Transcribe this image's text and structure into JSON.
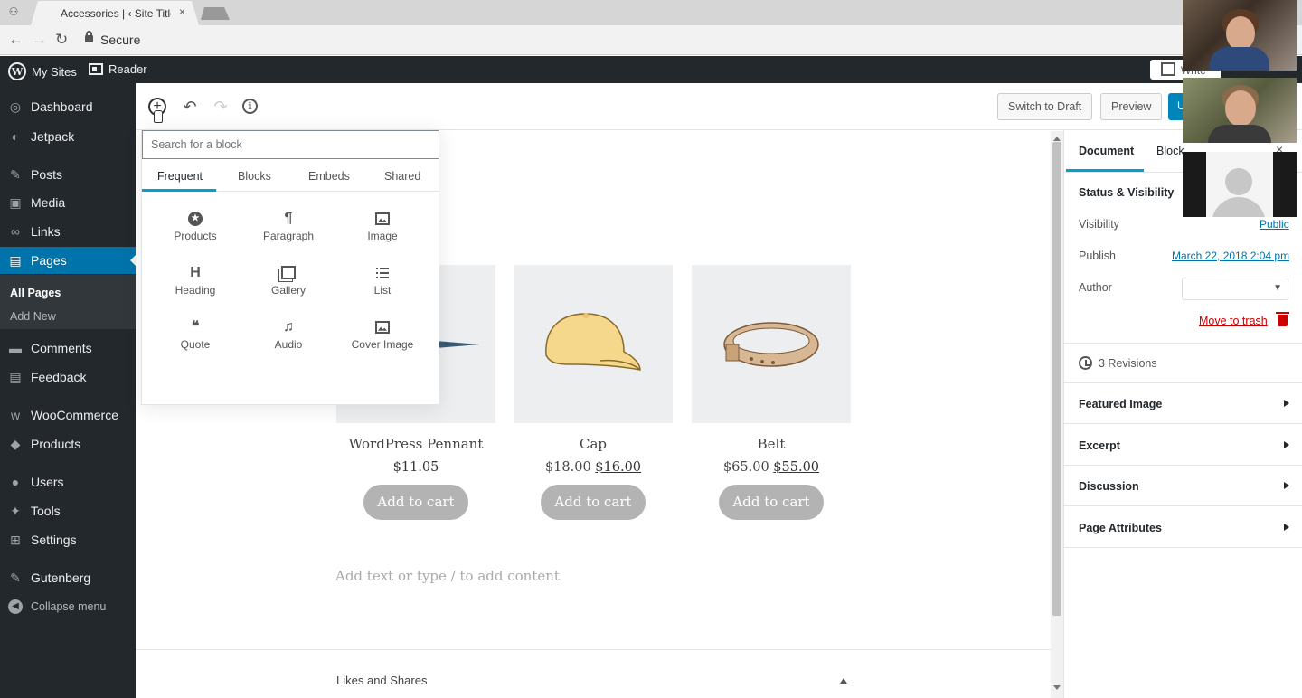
{
  "browser": {
    "tab_title": "Accessories | ‹ Site Title —",
    "tab_close": "×",
    "menu_icon": "incognito-icon",
    "omnibox_secure": "Secure",
    "back_icon": "←",
    "forward_icon": "→",
    "reload_icon": "↻"
  },
  "adminbar": {
    "my_sites": "My Sites",
    "reader": "Reader",
    "write": "Write"
  },
  "sidebar": {
    "items": [
      {
        "label": "Dashboard",
        "icon": "◎"
      },
      {
        "label": "Jetpack",
        "icon": "◐"
      },
      {
        "label": "Posts",
        "icon": "✎"
      },
      {
        "label": "Media",
        "icon": "▣"
      },
      {
        "label": "Links",
        "icon": "∞"
      },
      {
        "label": "Pages",
        "icon": "▤"
      },
      {
        "label": "Comments",
        "icon": "▬"
      },
      {
        "label": "Feedback",
        "icon": "▤"
      },
      {
        "label": "WooCommerce",
        "icon": "w"
      },
      {
        "label": "Products",
        "icon": "◆"
      },
      {
        "label": "Users",
        "icon": "●"
      },
      {
        "label": "Tools",
        "icon": "✦"
      },
      {
        "label": "Settings",
        "icon": "⊞"
      },
      {
        "label": "Gutenberg",
        "icon": "✎"
      }
    ],
    "submenu": [
      "All Pages",
      "Add New"
    ],
    "collapse": "Collapse menu",
    "collapse_icon": "◀"
  },
  "editor_header": {
    "inserter_icon": "+",
    "undo_icon": "↶",
    "redo_icon": "↷",
    "info_icon": "i",
    "switch_to_draft": "Switch to Draft",
    "preview": "Preview",
    "update": "U"
  },
  "inserter": {
    "search_placeholder": "Search for a block",
    "tabs": [
      "Frequent",
      "Blocks",
      "Embeds",
      "Shared"
    ],
    "blocks": [
      {
        "label": "Products",
        "icon": "products-icon"
      },
      {
        "label": "Paragraph",
        "icon": "¶"
      },
      {
        "label": "Image",
        "icon": "image-icon"
      },
      {
        "label": "Heading",
        "icon": "H"
      },
      {
        "label": "Gallery",
        "icon": "gallery-icon"
      },
      {
        "label": "List",
        "icon": "list-icon"
      },
      {
        "label": "Quote",
        "icon": "❝"
      },
      {
        "label": "Audio",
        "icon": "♫"
      },
      {
        "label": "Cover Image",
        "icon": "cover-image-icon"
      }
    ]
  },
  "content": {
    "heading_visible": "ories",
    "products": [
      {
        "name": "WordPress Pennant",
        "price": "$11.05",
        "old_price": "",
        "sale_price": "",
        "button": "Add to cart"
      },
      {
        "name": "Cap",
        "price": "",
        "old_price": "$18.00",
        "sale_price": "$16.00",
        "button": "Add to cart"
      },
      {
        "name": "Belt",
        "price": "",
        "old_price": "$65.00",
        "sale_price": "$55.00",
        "button": "Add to cart"
      }
    ],
    "placeholder": "Add text or type / to add content",
    "likes_and_shares": "Likes and Shares"
  },
  "settings": {
    "tabs": [
      "Document",
      "Block"
    ],
    "close_icon": "×",
    "status_visibility": "Status & Visibility",
    "visibility_label": "Visibility",
    "visibility_value": "Public",
    "publish_label": "Publish",
    "publish_value": "March 22, 2018 2:04 pm",
    "author_label": "Author",
    "move_to_trash": "Move to trash",
    "revisions": "3 Revisions",
    "sections": [
      "Featured Image",
      "Excerpt",
      "Discussion",
      "Page Attributes"
    ]
  },
  "colors": {
    "admin_dark": "#23282d",
    "accent": "#0073aa",
    "tab_highlight": "#00a0d2",
    "trash": "#cc0000"
  }
}
